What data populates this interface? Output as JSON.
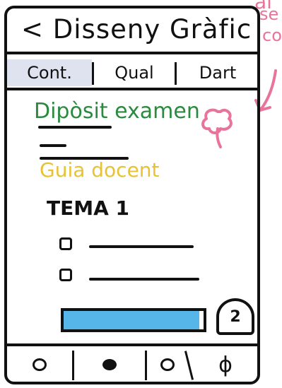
{
  "header": {
    "back_label": "<",
    "title": "Disseny Gràfic"
  },
  "tabs": [
    {
      "label": "Cont.",
      "active": true
    },
    {
      "label": "Qual",
      "active": false
    },
    {
      "label": "Dart",
      "active": false
    }
  ],
  "content": {
    "highlight_link": "Dipòsit examen",
    "guide_link": "Guia docent",
    "section_title": "TEMA 1",
    "progress": {
      "fraction": 0.97,
      "fill_color": "#56b5e9"
    },
    "badge_label": "2"
  },
  "bottom_nav": [
    {
      "icon": "circle-outline-icon"
    },
    {
      "icon": "circle-filled-icon"
    },
    {
      "icon": "circle-outline-icon"
    },
    {
      "icon": "phi-icon",
      "glyph": "ϕ"
    }
  ],
  "annotations": {
    "line1": "al",
    "line2": "se",
    "line3": "co"
  },
  "colors": {
    "green_link": "#2a8a3f",
    "yellow_link": "#e8c233",
    "annotation_pink": "#e8749c",
    "active_tab_bg": "#dfe3ef"
  }
}
